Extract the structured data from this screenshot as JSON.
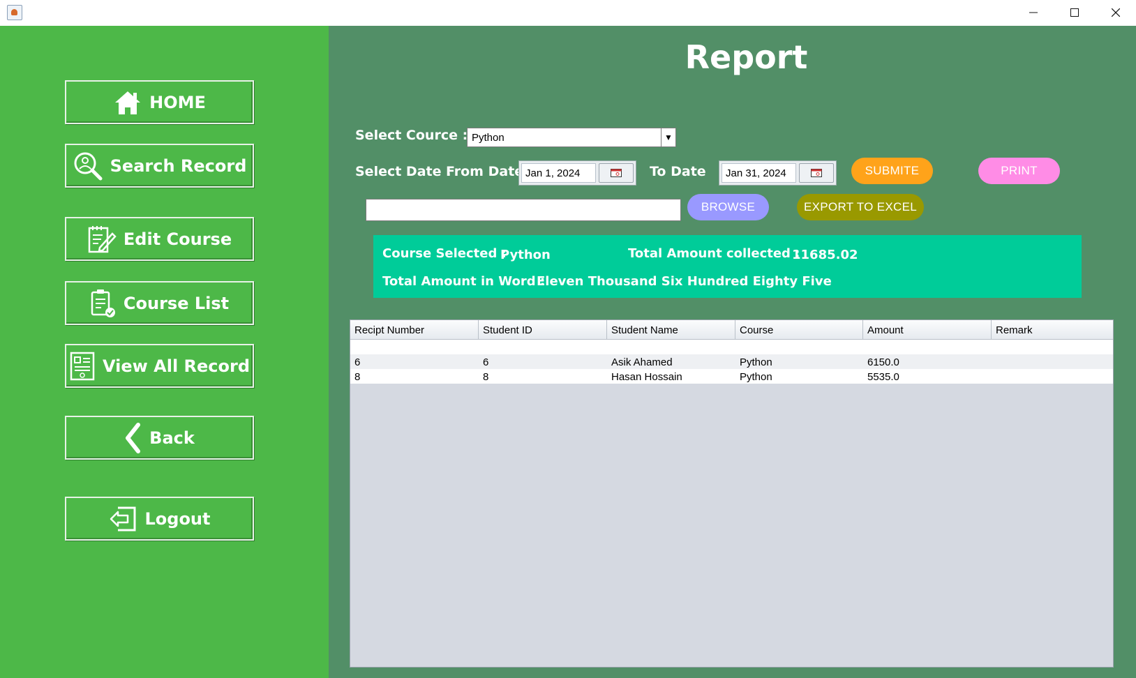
{
  "window": {
    "minimize_icon": "minimize-icon",
    "maximize_icon": "maximize-icon",
    "close_icon": "close-icon"
  },
  "sidebar": {
    "items": [
      {
        "label": "HOME",
        "icon": "home-icon"
      },
      {
        "label": "Search Record",
        "icon": "search-person-icon"
      },
      {
        "label": "Edit Course",
        "icon": "edit-document-icon"
      },
      {
        "label": "Course List",
        "icon": "clipboard-check-icon"
      },
      {
        "label": "View All Record",
        "icon": "record-list-icon"
      },
      {
        "label": "Back",
        "icon": "chevron-left-icon"
      },
      {
        "label": "Logout",
        "icon": "logout-icon"
      }
    ]
  },
  "main": {
    "title": "Report",
    "select_course_label": "Select Cource :",
    "course_value": "Python",
    "select_date_label": "Select Date :",
    "from_date_label": "From Date",
    "from_date_value": "Jan 1, 2024",
    "to_date_label": "To Date",
    "to_date_value": "Jan 31, 2024",
    "submit_label": "SUBMITE",
    "print_label": "PRINT",
    "browse_label": "BROWSE",
    "export_label": "EXPORT TO EXCEL",
    "path_value": ""
  },
  "summary": {
    "course_selected_label": "Course Selected :",
    "course_selected_value": "Python",
    "total_amount_label": "Total Amount collected :",
    "total_amount_value": "11685.02",
    "amount_in_word_label": "Total Amount in Word :",
    "amount_in_word_value": "Eleven Thousand Six Hundred Eighty Five"
  },
  "table": {
    "columns": [
      "Recipt Number",
      "Student ID",
      "Student Name",
      "Course",
      "Amount",
      "Remark"
    ],
    "rows": [
      [
        "",
        "",
        "",
        "",
        "",
        ""
      ],
      [
        "6",
        "6",
        "Asik Ahamed",
        "Python",
        "6150.0",
        ""
      ],
      [
        "8",
        "8",
        "Hasan Hossain",
        "Python",
        "5535.0",
        ""
      ]
    ]
  },
  "colors": {
    "sidebar": "#4db848",
    "main": "#528f67",
    "summary": "#00cc99",
    "submit": "#ffa31a",
    "print": "#ff8ce6",
    "browse": "#9999ff",
    "export": "#999900"
  }
}
